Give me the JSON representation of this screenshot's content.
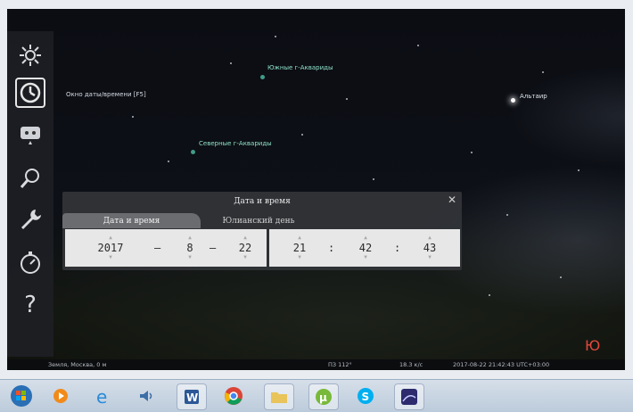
{
  "sky": {
    "labels": {
      "southern_aquariids": "Южные г-Аквариды",
      "northern_aquariids": "Северные г-Аквариды",
      "altair": "Альтаир"
    },
    "tooltip": "Окно даты/времени [F5]"
  },
  "toolbar": {
    "items": [
      {
        "icon": "sun-icon"
      },
      {
        "icon": "clock-icon",
        "active": true
      },
      {
        "icon": "chat-icon"
      },
      {
        "icon": "search-icon"
      },
      {
        "icon": "wrench-icon"
      },
      {
        "icon": "stopwatch-icon"
      },
      {
        "icon": "help-icon",
        "label": "?"
      }
    ]
  },
  "dialog": {
    "title": "Дата и время",
    "close": "✕",
    "tabs": [
      {
        "label": "Дата и время",
        "active": true
      },
      {
        "label": "Юлианский день",
        "active": false
      }
    ],
    "date": {
      "year": "2017",
      "month": "8",
      "day": "22"
    },
    "time": {
      "hour": "21",
      "minute": "42",
      "second": "43"
    },
    "date_separator": "–",
    "time_separator": ":"
  },
  "status": {
    "location": "Земля, Москва, 0 м",
    "fov": "ПЗ 112°",
    "fps": "18.3 к/с",
    "datetime": "2017-08-22 21:42:43 UTC+03:00"
  },
  "compass": "Ю",
  "colors": {
    "compass": "#e0483d",
    "sky_label": "#8fe0c8"
  },
  "taskbar": {
    "items": [
      {
        "icon": "windows-start-icon"
      },
      {
        "icon": "media-player-icon"
      },
      {
        "icon": "internet-explorer-icon"
      },
      {
        "icon": "volume-icon"
      },
      {
        "icon": "word-icon",
        "boxed": true
      },
      {
        "icon": "chrome-icon"
      },
      {
        "icon": "folder-icon",
        "boxed": true
      },
      {
        "icon": "utorrent-icon",
        "boxed": true
      },
      {
        "icon": "skype-icon"
      },
      {
        "icon": "stellarium-icon",
        "boxed": true
      }
    ]
  }
}
